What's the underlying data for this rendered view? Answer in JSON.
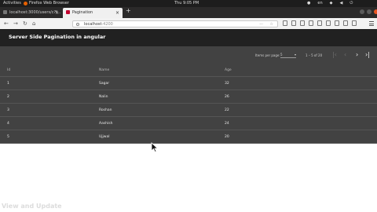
{
  "system_bar": {
    "activities": "Activities",
    "app_name": "Firefox Web Browser",
    "clock": "Thu 9:05 PM",
    "lang": "en"
  },
  "tabs": [
    {
      "title": "localhost:3000/users/c?f..."
    },
    {
      "title": "Pagination"
    }
  ],
  "address_bar": {
    "host": "localhost",
    "port": ":4200"
  },
  "app": {
    "title": "Server Side Pagination in angular",
    "paginator": {
      "items_per_page_label": "Items per page:",
      "page_size": "5",
      "range_label": "1 – 5 of 20"
    },
    "table": {
      "headers": [
        "Id",
        "Name",
        "Age"
      ],
      "rows": [
        [
          "1",
          "Sagar",
          "32"
        ],
        [
          "2",
          "Nalin",
          "26"
        ],
        [
          "3",
          "Roshan",
          "22"
        ],
        [
          "4",
          "Aashish",
          "24"
        ],
        [
          "5",
          "Ujjwal",
          "20"
        ]
      ]
    }
  },
  "watermark": "View and Update",
  "colors": {
    "toolbar": "#212121",
    "table_bg": "#424242",
    "firefox": "#e66000"
  }
}
